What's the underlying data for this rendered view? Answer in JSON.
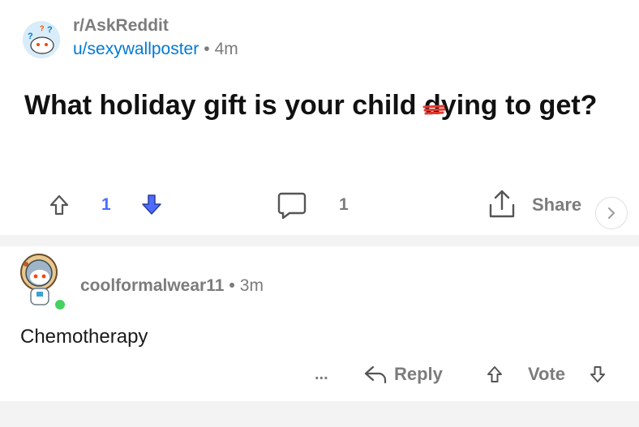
{
  "post": {
    "subreddit": "r/AskReddit",
    "author": "u/sexywallposter",
    "separator": "•",
    "time": "4m",
    "title_before": "What holiday gift is your child ",
    "title_struck": "dying",
    "title_after": " to get?",
    "vote_count": "1",
    "comment_count": "1",
    "share_label": "Share"
  },
  "comment": {
    "username": "coolformalwear11",
    "separator": "•",
    "time": "3m",
    "body": "Chemotherapy",
    "more_label": "...",
    "reply_label": "Reply",
    "vote_label": "Vote"
  },
  "colors": {
    "accent_blue": "#0079d3",
    "downvote_active": "#4d6cff",
    "online_green": "#46d160",
    "strike_red": "#e8382f"
  },
  "icons": {
    "upvote": "upvote-arrow-icon",
    "downvote": "downvote-arrow-icon",
    "comment": "speech-bubble-icon",
    "share": "share-upload-icon",
    "reply": "reply-arrow-icon"
  }
}
